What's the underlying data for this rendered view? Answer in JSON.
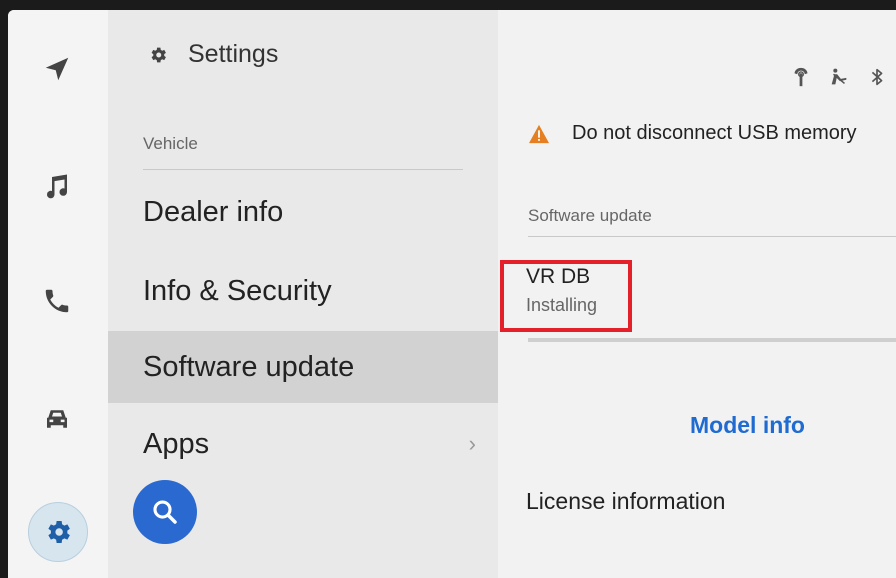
{
  "rail": {
    "items": [
      {
        "icon": "navigation-arrow-icon"
      },
      {
        "icon": "music-note-icon"
      },
      {
        "icon": "phone-icon"
      },
      {
        "icon": "car-icon"
      },
      {
        "icon": "gear-icon",
        "active": true
      }
    ]
  },
  "menu": {
    "title": "Settings",
    "section_label": "Vehicle",
    "items": [
      {
        "label": "Dealer info"
      },
      {
        "label": "Info & Security"
      },
      {
        "label": "Software update",
        "active": true
      },
      {
        "label": "Apps",
        "chevron": "›"
      }
    ],
    "search_icon": "search-icon"
  },
  "content": {
    "status_icons": [
      "wireless-charging-icon",
      "seatbelt-icon",
      "bluetooth-icon"
    ],
    "warning": {
      "icon": "warning-triangle-icon",
      "text": "Do not disconnect USB memory"
    },
    "section_label": "Software update",
    "update": {
      "name": "VR DB",
      "status": "Installing",
      "progress": 0
    },
    "model_info_label": "Model info",
    "license_label": "License information"
  },
  "colors": {
    "accent": "#2a69cf",
    "link": "#1f6bd1",
    "warning": "#e67e22",
    "highlight": "#e4202a"
  }
}
